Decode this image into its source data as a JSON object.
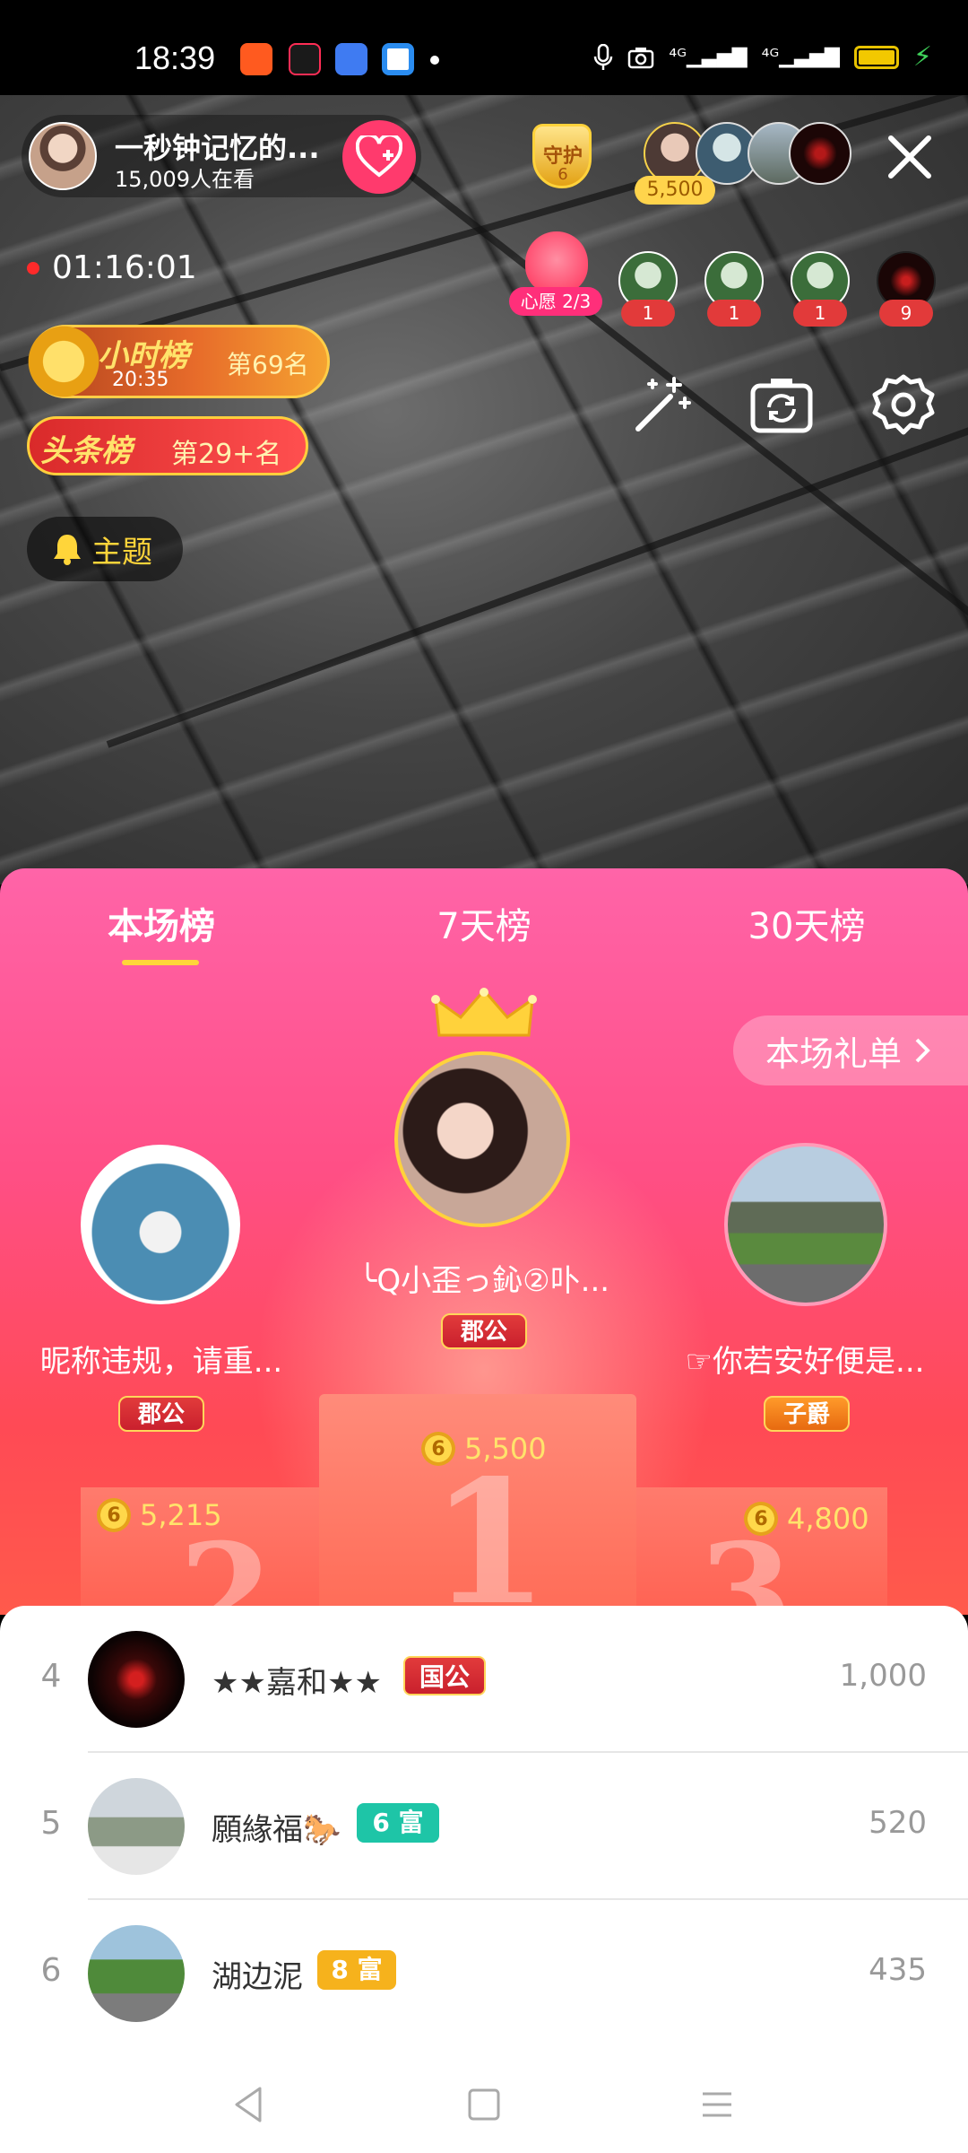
{
  "status_bar": {
    "time": "18:39",
    "network1": "⁴ᴳ",
    "network2": "⁴ᴳ",
    "colors": {
      "battery": "#f2c800",
      "charging": "#3fd15a"
    }
  },
  "header": {
    "host_name": "一秒钟记忆的...",
    "viewers": "15,009人在看",
    "guard_label": "守护",
    "guard_count": "6",
    "top_gift_amount": "5,500"
  },
  "left_info": {
    "timer": "01:16:01",
    "hourly_title": "小时榜",
    "hourly_time": "20:35",
    "hourly_rank": "第69名",
    "headline_title": "头条榜",
    "headline_rank": "第29+名",
    "theme_label": "主题"
  },
  "right_info": {
    "wish_label": "心愿 2/3",
    "top_fans": [
      {
        "count": "1"
      },
      {
        "count": "1"
      },
      {
        "count": "1"
      },
      {
        "count": "9"
      }
    ],
    "tools": [
      "magic-wand-icon",
      "camera-flip-icon",
      "settings-icon"
    ]
  },
  "rank_panel": {
    "tabs": [
      "本场榜",
      "7天榜",
      "30天榜"
    ],
    "active_tab": 0,
    "gift_list_label": "本场礼单",
    "podium": [
      {
        "place": "1",
        "name": "╰Q小歪っ鈊②卟...",
        "noble": "郡公",
        "coins": "5,500"
      },
      {
        "place": "2",
        "name": "昵称违规，请重...",
        "noble": "郡公",
        "coins": "5,215"
      },
      {
        "place": "3",
        "name": "☞你若安好便是...",
        "noble": "子爵",
        "coins": "4,800"
      }
    ],
    "coin_glyph": "6",
    "colors": {
      "accent": "#ffd53a",
      "panel_top": "#ff64a8",
      "panel_bottom": "#ff5a4b"
    }
  },
  "list": [
    {
      "rank": "4",
      "name": "★★嘉和★★",
      "badge": "国公",
      "score": "1,000"
    },
    {
      "rank": "5",
      "name": "願緣福🐎",
      "badge": "6 富",
      "score": "520"
    },
    {
      "rank": "6",
      "name": "湖边泥",
      "badge": "8 富",
      "score": "435"
    }
  ],
  "navbar": [
    "back-icon",
    "home-icon",
    "menu-icon"
  ]
}
